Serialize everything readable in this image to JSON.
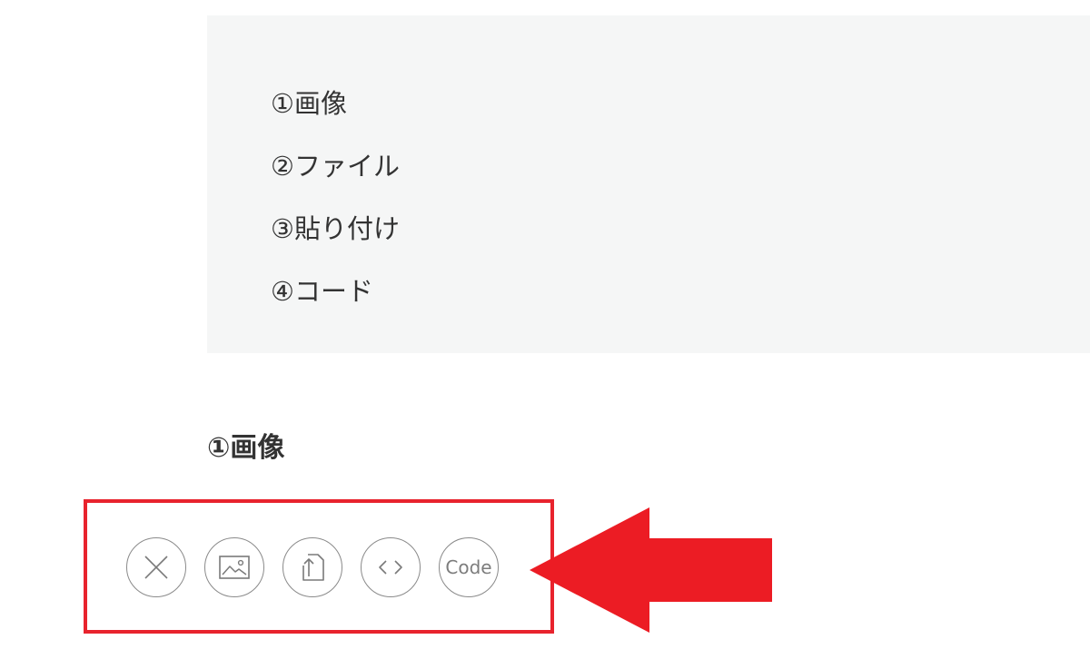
{
  "toc": {
    "items": [
      {
        "label": "①画像"
      },
      {
        "label": "②ファイル"
      },
      {
        "label": "③貼り付け"
      },
      {
        "label": "④コード"
      }
    ]
  },
  "section": {
    "heading": "①画像"
  },
  "toolbar": {
    "buttons": [
      {
        "icon": "close-icon"
      },
      {
        "icon": "image-icon"
      },
      {
        "icon": "upload-file-icon"
      },
      {
        "icon": "embed-code-icon"
      },
      {
        "icon": "code-block-icon",
        "label": "Code"
      }
    ]
  },
  "annotation": {
    "highlight_color": "#e8232d",
    "arrow_color": "#ec1c24"
  }
}
